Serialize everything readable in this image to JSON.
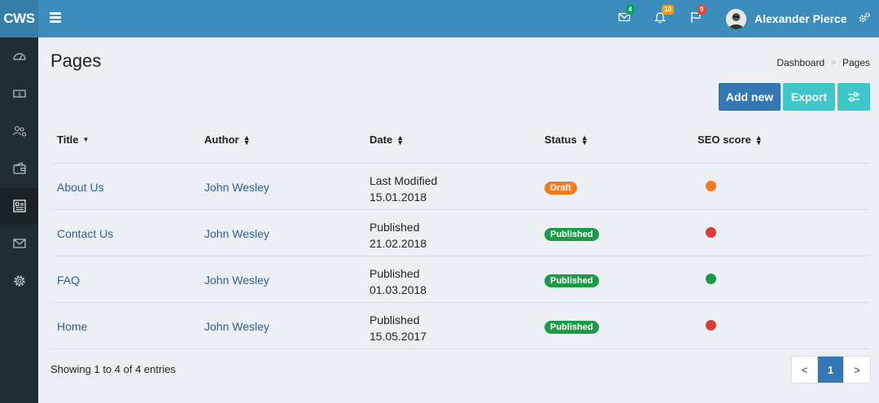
{
  "app": {
    "logo": "CWS"
  },
  "header": {
    "messages_count": "4",
    "notifications_count": "10",
    "flags_count": "9",
    "user_name": "Alexander Pierce",
    "colors": {
      "bar": "#3c8dbc",
      "badge_green": "#00a65a",
      "badge_orange": "#f39c12",
      "badge_red": "#dd4b39"
    }
  },
  "sidebar": {
    "items": [
      {
        "icon": "dashboard-gauge-icon"
      },
      {
        "icon": "money-icon"
      },
      {
        "icon": "users-icon"
      },
      {
        "icon": "wallet-icon"
      },
      {
        "icon": "pages-icon",
        "active": true
      },
      {
        "icon": "mail-icon"
      },
      {
        "icon": "settings-gear-icon"
      }
    ]
  },
  "page": {
    "title": "Pages",
    "breadcrumb": [
      "Dashboard",
      ">",
      "Pages"
    ]
  },
  "toolbar": {
    "add_label": "Add new",
    "export_label": "Export",
    "settings_icon": "sliders-icon"
  },
  "table": {
    "columns": [
      "Title",
      "Author",
      "Date",
      "Status",
      "SEO score"
    ],
    "rows": [
      {
        "title": "About Us",
        "author": "John Wesley",
        "date_label": "Last Modified",
        "date": "15.01.2018",
        "status": "Draft",
        "status_color": "#f47b20",
        "seo_color": "#f47b20"
      },
      {
        "title": "Contact Us",
        "author": "John Wesley",
        "date_label": "Published",
        "date": "21.02.2018",
        "status": "Published",
        "status_color": "#1d9a47",
        "seo_color": "#dd3b35"
      },
      {
        "title": "FAQ",
        "author": "John Wesley",
        "date_label": "Published",
        "date": "01.03.2018",
        "status": "Published",
        "status_color": "#1d9a47",
        "seo_color": "#1d9a47"
      },
      {
        "title": "Home",
        "author": "John Wesley",
        "date_label": "Published",
        "date": "15.05.2017",
        "status": "Published",
        "status_color": "#1d9a47",
        "seo_color": "#dd3b35"
      }
    ]
  },
  "footer": {
    "showing": "Showing 1 to 4 of 4 entries",
    "pagination": {
      "prev": "<",
      "current": "1",
      "next": ">"
    }
  }
}
